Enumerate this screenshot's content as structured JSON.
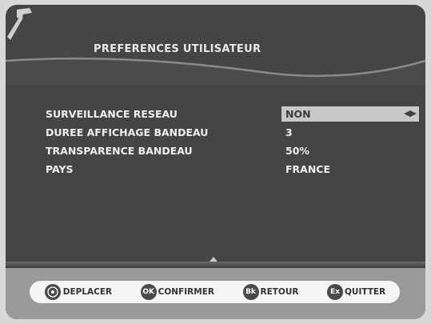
{
  "header": {
    "title": "PREFERENCES UTILISATEUR"
  },
  "settings": [
    {
      "label": "SURVEILLANCE RESEAU",
      "value": "NON",
      "selected": true
    },
    {
      "label": "DUREE AFFICHAGE BANDEAU",
      "value": "3"
    },
    {
      "label": "TRANSPARENCE BANDEAU",
      "value": "50%"
    },
    {
      "label": "PAYS",
      "value": "FRANCE"
    }
  ],
  "selected_arrows": "◀▶",
  "footer": {
    "buttons": [
      {
        "key": "",
        "label": "DEPLACER",
        "icon": "dpad-icon"
      },
      {
        "key": "OK",
        "label": "CONFIRMER"
      },
      {
        "key": "Bk",
        "label": "RETOUR"
      },
      {
        "key": "Ex",
        "label": "QUITTER"
      }
    ]
  },
  "colors": {
    "background": "#454545",
    "highlight": "#c8c8c8",
    "footer": "#9a9a9a"
  }
}
